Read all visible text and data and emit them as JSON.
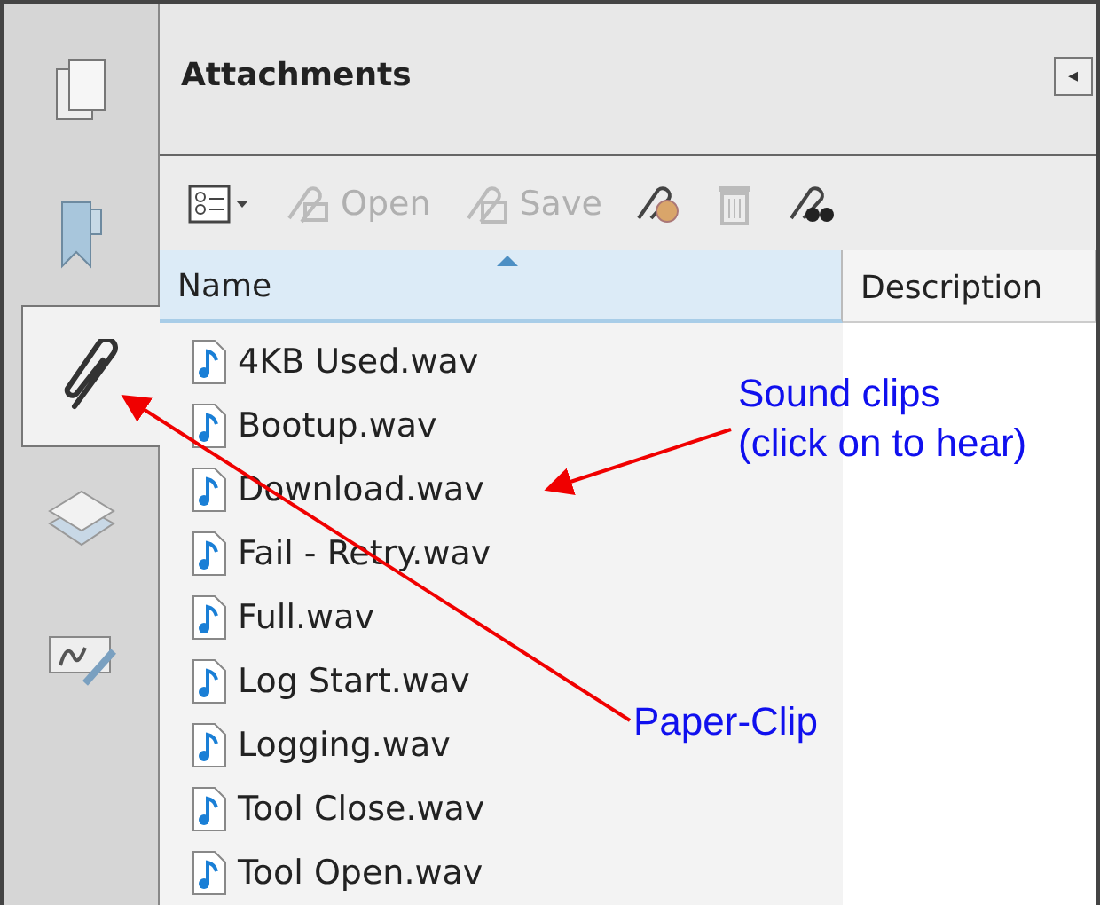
{
  "sidebar": {
    "tabs": [
      {
        "kind": "pages",
        "selected": false
      },
      {
        "kind": "bookmarks",
        "selected": false
      },
      {
        "kind": "attachments",
        "selected": true
      },
      {
        "kind": "layers",
        "selected": false
      },
      {
        "kind": "signatures",
        "selected": false
      }
    ]
  },
  "panel": {
    "title": "Attachments",
    "collapse_button": "◂"
  },
  "toolbar": [
    {
      "kind": "options",
      "disabled": false
    },
    {
      "kind": "open",
      "label": "Open",
      "disabled": true
    },
    {
      "kind": "save",
      "label": "Save",
      "disabled": true
    },
    {
      "kind": "add",
      "disabled": false
    },
    {
      "kind": "delete",
      "disabled": true
    },
    {
      "kind": "search",
      "disabled": false
    }
  ],
  "table": {
    "columns": [
      {
        "label": "Name",
        "sorted": true
      },
      {
        "label": "Description",
        "sorted": false
      }
    ],
    "rows": [
      {
        "name": "4KB Used.wav"
      },
      {
        "name": "Bootup.wav"
      },
      {
        "name": "Download.wav"
      },
      {
        "name": "Fail - Retry.wav"
      },
      {
        "name": "Full.wav"
      },
      {
        "name": "Log Start.wav"
      },
      {
        "name": "Logging.wav"
      },
      {
        "name": "Tool Close.wav"
      },
      {
        "name": "Tool Open.wav"
      }
    ]
  },
  "annotations": [
    {
      "lines": [
        "Sound clips",
        "(click on to hear)"
      ]
    },
    {
      "lines": [
        "Paper-Clip"
      ]
    }
  ]
}
